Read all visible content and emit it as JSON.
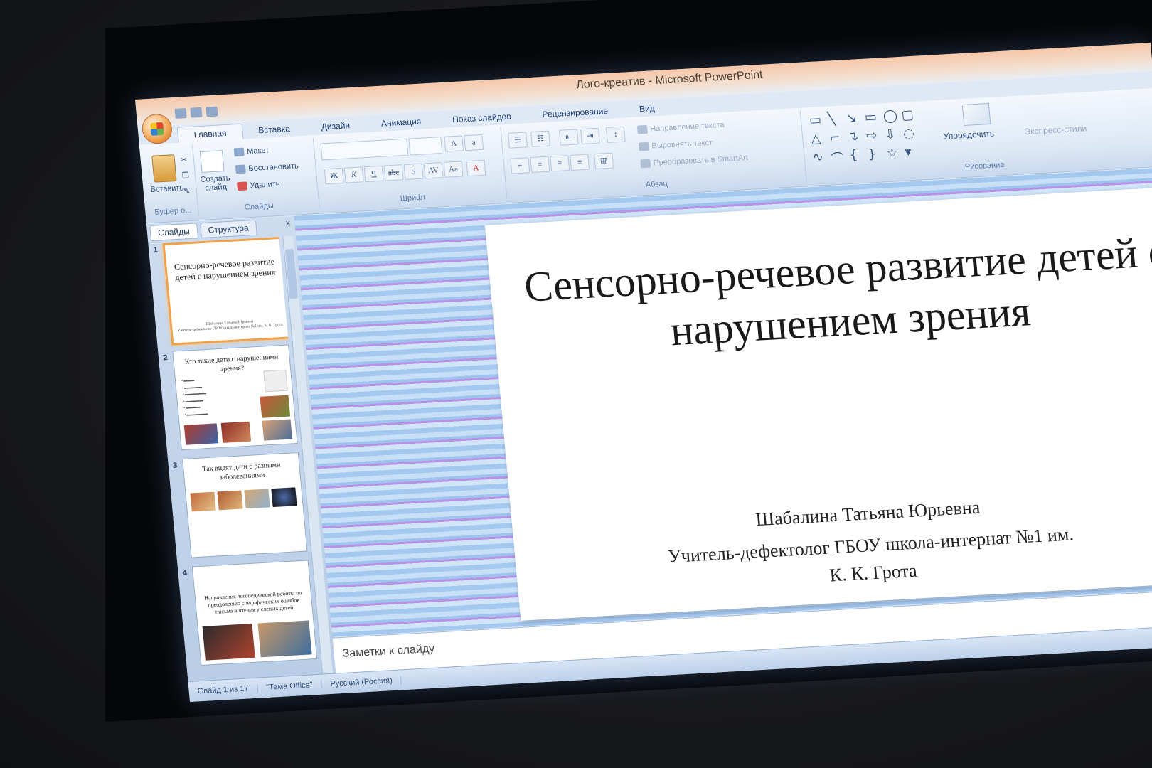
{
  "window": {
    "title": "Лого-креатив - Microsoft PowerPoint"
  },
  "ribbon": {
    "tabs": [
      "Главная",
      "Вставка",
      "Дизайн",
      "Анимация",
      "Показ слайдов",
      "Рецензирование",
      "Вид"
    ],
    "active_tab": "Главная",
    "clipboard": {
      "paste": "Вставить",
      "label": "Буфер о..."
    },
    "slides_group": {
      "new_slide": "Создать слайд",
      "layout": "Макет",
      "reset": "Восстановить",
      "delete": "Удалить",
      "label": "Слайды"
    },
    "font_group": {
      "label": "Шрифт"
    },
    "paragraph_group": {
      "text_direction": "Направление текста",
      "align_text": "Выровнять текст",
      "convert_smartart": "Преобразовать в SmartArt",
      "label": "Абзац"
    },
    "drawing_group": {
      "arrange": "Упорядочить",
      "quick_styles": "Экспресс-стили",
      "label": "Рисование"
    }
  },
  "left_pane": {
    "tabs": [
      "Слайды",
      "Структура"
    ],
    "close": "x",
    "thumbnails": [
      {
        "num": "1",
        "title": "Сенсорно-речевое развитие детей с нарушением зрения",
        "sub1": "Шабалина Татьяна Юрьевна",
        "sub2": "Учитель-дефектолог ГБОУ школа-интернат №1 им. К. К. Грота"
      },
      {
        "num": "2",
        "title": "Кто такие дети с нарушениями зрения?"
      },
      {
        "num": "3",
        "title": "Так видят дети с разными заболеваниями"
      },
      {
        "num": "4",
        "title": "Направления логопедической работы по преодолению специфических ошибок письма и чтения у слепых детей"
      }
    ]
  },
  "slide": {
    "title": "Сенсорно-речевое развитие детей с нарушением зрения",
    "author": "Шабалина Татьяна Юрьевна",
    "role_line1": "Учитель-дефектолог ГБОУ школа-интернат №1 им.",
    "role_line2": "К. К. Грота"
  },
  "notes": {
    "placeholder": "Заметки к слайду"
  },
  "status": {
    "slide_pos": "Слайд 1 из 17",
    "theme": "\"Тема Office\"",
    "lang": "Русский (Россия)"
  },
  "colors": {
    "accent": "#f0a14a",
    "ribbon": "#dde8f5",
    "text_blue": "#1f3f75"
  }
}
